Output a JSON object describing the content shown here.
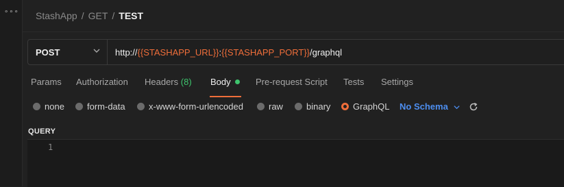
{
  "breadcrumb": {
    "collection": "StashApp",
    "folder": "GET",
    "request": "TEST"
  },
  "request": {
    "method": "POST",
    "url_parts": {
      "prefix": "http://",
      "var1": "{{STASHAPP_URL}}",
      "colon": ":",
      "var2": "{{STASHAPP_PORT}}",
      "suffix": "/graphql"
    }
  },
  "tabs": {
    "params": "Params",
    "authorization": "Authorization",
    "headers": "Headers",
    "headers_count": "(8)",
    "body": "Body",
    "pre_request": "Pre-request Script",
    "tests": "Tests",
    "settings": "Settings"
  },
  "body_types": {
    "none": "none",
    "form_data": "form-data",
    "urlencoded": "x-www-form-urlencoded",
    "raw": "raw",
    "binary": "binary",
    "graphql": "GraphQL",
    "selected": "GraphQL"
  },
  "schema": {
    "label": "No Schema"
  },
  "query": {
    "label": "QUERY",
    "line_number": "1"
  },
  "colors": {
    "accent": "#ef6e3a",
    "variable": "#ef6e3a",
    "schema_link": "#4d8ef0",
    "success": "#3ec46d"
  },
  "icons": {
    "menu": "more-dots-icon",
    "method_dropdown": "chevron-down-icon",
    "schema_dropdown": "chevron-down-icon",
    "refresh": "refresh-icon"
  }
}
